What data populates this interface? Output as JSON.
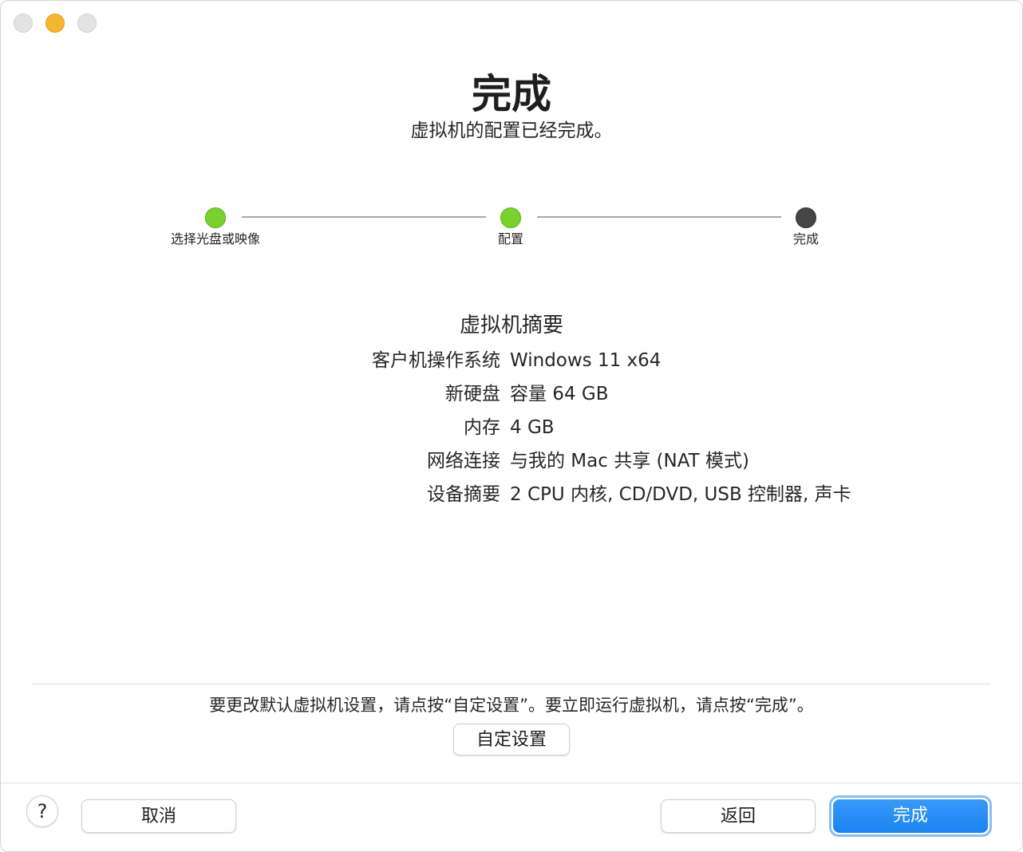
{
  "header": {
    "title": "完成",
    "subtitle": "虚拟机的配置已经完成。"
  },
  "steps": [
    {
      "label": "选择光盘或映像",
      "status": "done"
    },
    {
      "label": "配置",
      "status": "done"
    },
    {
      "label": "完成",
      "status": "current"
    }
  ],
  "summary": {
    "title": "虚拟机摘要",
    "rows": [
      {
        "key": "客户机操作系统",
        "value": "Windows 11 x64"
      },
      {
        "key": "新硬盘",
        "value": "容量 64 GB"
      },
      {
        "key": "内存",
        "value": "4 GB"
      },
      {
        "key": "网络连接",
        "value": "与我的 Mac 共享 (NAT 模式)"
      },
      {
        "key": "设备摘要",
        "value": "2 CPU 内核, CD/DVD, USB 控制器, 声卡"
      }
    ]
  },
  "footer": {
    "hint": "要更改默认虚拟机设置，请点按“自定设置”。要立即运行虚拟机，请点按“完成”。",
    "customize_label": "自定设置",
    "help_label": "?",
    "cancel_label": "取消",
    "back_label": "返回",
    "finish_label": "完成"
  },
  "colors": {
    "step_done": "#79d22b",
    "step_current": "#454545",
    "primary_button": "#1f8bf7",
    "minimize": "#f7b52e"
  }
}
